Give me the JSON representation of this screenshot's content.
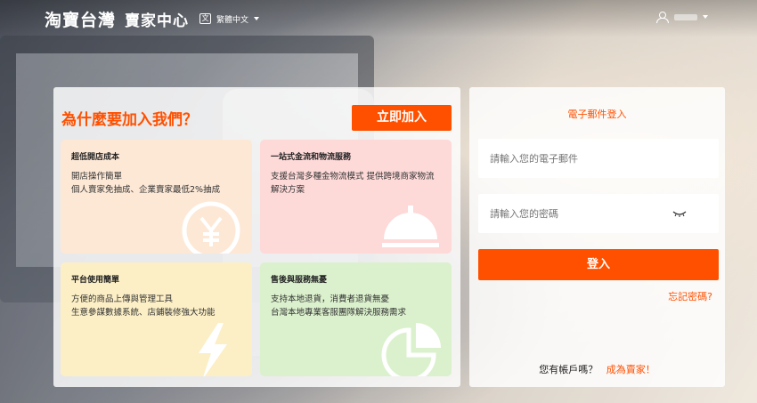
{
  "header": {
    "brand": "淘寶台灣",
    "brand_sub": "賣家中心",
    "lang_icon_glyph": "文",
    "language": "繁體中文"
  },
  "promo": {
    "heading": "為什麼要加入我們？",
    "join_button": "立即加入",
    "cards": [
      {
        "title": "超低開店成本",
        "lines": [
          "開店操作簡單",
          "個人賣家免抽成、企業賣家最低2%抽成"
        ],
        "icon": "yen-coin-icon",
        "color": "#fde8d6"
      },
      {
        "title": "一站式金流和物流服務",
        "lines": [
          "支援台灣多種金物流模式 提供跨境商家物流",
          "解決方案"
        ],
        "icon": "service-bell-icon",
        "color": "#fdd9d8"
      },
      {
        "title": "平台使用簡單",
        "lines": [
          "方便的商品上傳與管理工具",
          "生意參謀數據系統、店鋪裝修強大功能"
        ],
        "icon": "lightning-icon",
        "color": "#fcefc6"
      },
      {
        "title": "售後與服務無憂",
        "lines": [
          "支持本地退貨，消費者退貨無憂",
          "台灣本地專業客服團隊解決服務需求"
        ],
        "icon": "pie-chart-icon",
        "color": "#dbf1cd"
      }
    ]
  },
  "login": {
    "title": "電子郵件登入",
    "email_placeholder": "請輸入您的電子郵件",
    "password_placeholder": "請輸入您的密碼",
    "login_button": "登入",
    "forgot": "忘記密碼?",
    "has_account": "您有帳戶嗎？",
    "become_seller": "成為賣家！"
  },
  "colors": {
    "accent": "#ff5000"
  }
}
